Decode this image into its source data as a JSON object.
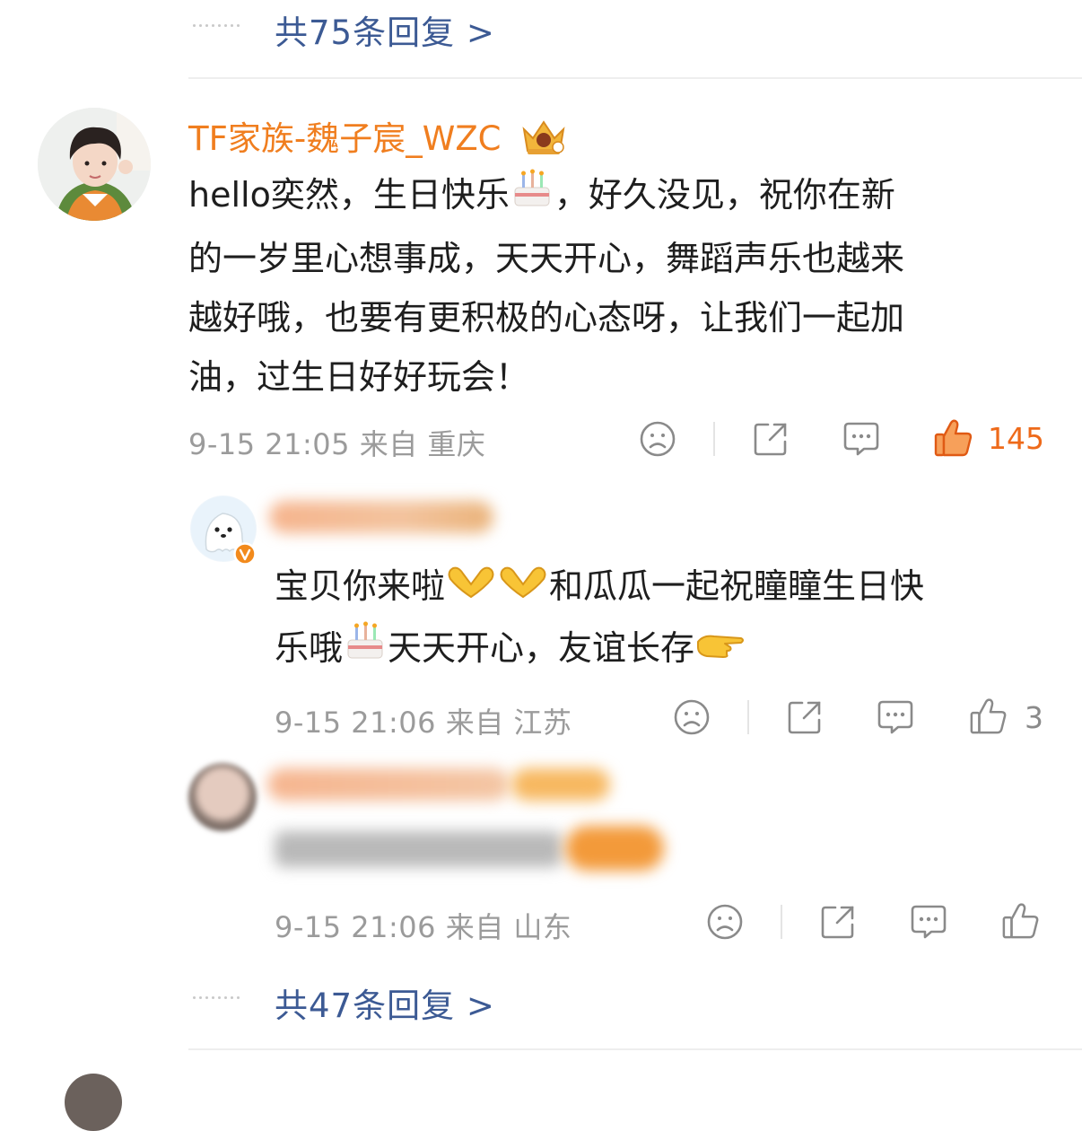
{
  "top_replies": {
    "label": "共75条回复 >"
  },
  "comment1": {
    "username": "TF家族-魏子宸_WZC",
    "text": [
      "hello奕然，生日快乐",
      "，好久没见，祝你在新",
      "的一岁里心想事成，天天开心，舞蹈声乐也越来",
      "越好哦，也要有更积极的心态呀，让我们一起加",
      "油，过生日好好玩会！"
    ],
    "meta": "9-15 21:05 来自 重庆",
    "likes": "145",
    "icons": [
      "dislike-face-icon",
      "share-icon",
      "comment-icon",
      "thumbs-up-icon"
    ],
    "colors": {
      "username": "#f07e1f",
      "like_active": "#ee6a1a"
    }
  },
  "reply1": {
    "text_line1": "宝贝你来啦",
    "text_line1b": "和瓜瓜一起祝瞳瞳生日快",
    "text_line2a": "乐哦",
    "text_line2b": "天天开心，友谊长存",
    "meta": "9-15 21:06 来自 江苏",
    "likes": "3"
  },
  "reply2": {
    "meta": "9-15 21:06 来自 山东"
  },
  "bottom_replies": {
    "label": "共47条回复 >"
  },
  "colors": {
    "link": "#3c5a94",
    "meta": "#9b9b9b"
  }
}
